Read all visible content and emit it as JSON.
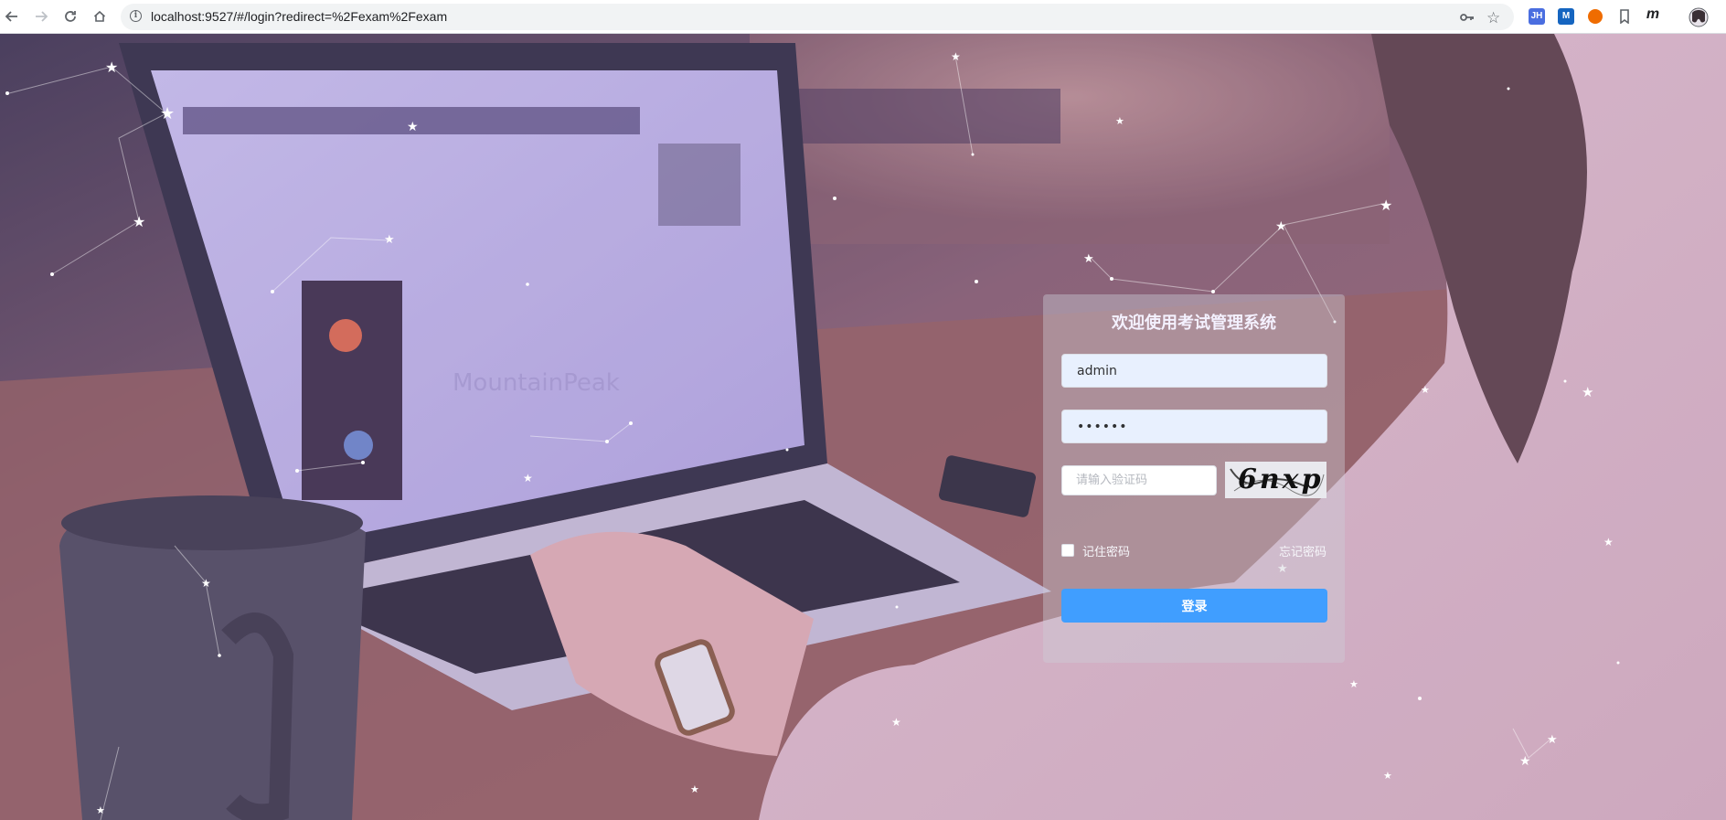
{
  "browser": {
    "url": "localhost:9527/#/login?redirect=%2Fexam%2Fexam",
    "extensions": [
      {
        "name": "jh-extension",
        "label": "JH",
        "color": "#4a6ee0"
      },
      {
        "name": "m-extension",
        "label": "M",
        "color": "#1565c0"
      },
      {
        "name": "orange-extension",
        "label": "",
        "color": "#ef6c00"
      },
      {
        "name": "italic-m-extension",
        "label": "m",
        "color": ""
      }
    ]
  },
  "login": {
    "title": "欢迎使用考试管理系统",
    "username_value": "admin",
    "password_value": "••••••",
    "captcha_placeholder": "请输入验证码",
    "captcha_text": "6nxp",
    "remember_label": "记住密码",
    "forgot_label": "忘记密码",
    "submit_label": "登录"
  },
  "theme": {
    "accent": "#409eff",
    "input_bg": "#e8f0fe"
  }
}
